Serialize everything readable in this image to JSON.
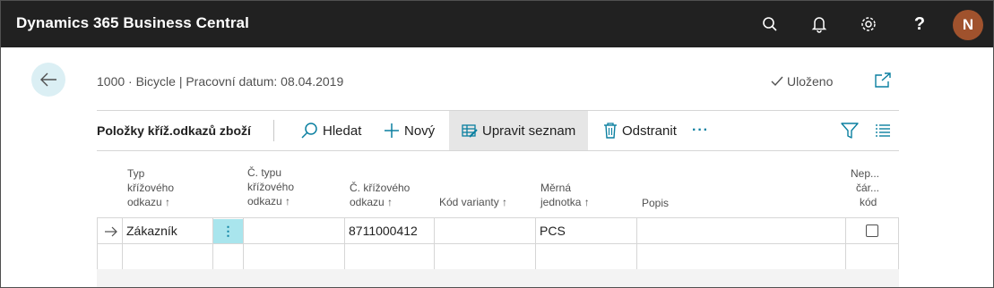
{
  "app": {
    "title": "Dynamics 365 Business Central",
    "user_initial": "N"
  },
  "topbar_icons": [
    "search-icon",
    "bell-icon",
    "gear-icon",
    "help-icon"
  ],
  "header": {
    "breadcrumb": "1000 · Bicycle | Pracovní datum: 08.04.2019",
    "saved_label": "Uloženo"
  },
  "actionbar": {
    "caption": "Položky kříž.odkazů zboží",
    "search_label": "Hledat",
    "new_label": "Nový",
    "edit_list_label": "Upravit seznam",
    "delete_label": "Odstranit",
    "more_label": "···"
  },
  "columns": {
    "type": [
      "Typ",
      "křížového",
      "odkazu ↑"
    ],
    "type_no": [
      "Č. typu",
      "křížového",
      "odkazu ↑"
    ],
    "cross_ref_no": [
      "Č. křížového",
      "odkazu ↑"
    ],
    "variant": [
      "Kód varianty ↑"
    ],
    "uom": [
      "Měrná",
      "jednotka ↑"
    ],
    "description": [
      "Popis"
    ],
    "discontinue": [
      "Nep...",
      "čár...",
      "kód"
    ]
  },
  "rows": [
    {
      "type": "Zákazník",
      "type_no": "",
      "cross_ref_no": "8711000412",
      "variant": "",
      "uom": "PCS",
      "description": "",
      "discontinue": false
    }
  ],
  "colors": {
    "topbar": "#212121",
    "accent": "#00b7c3",
    "back_button_bg": "#dbeff4",
    "avatar": "#a0522d"
  }
}
